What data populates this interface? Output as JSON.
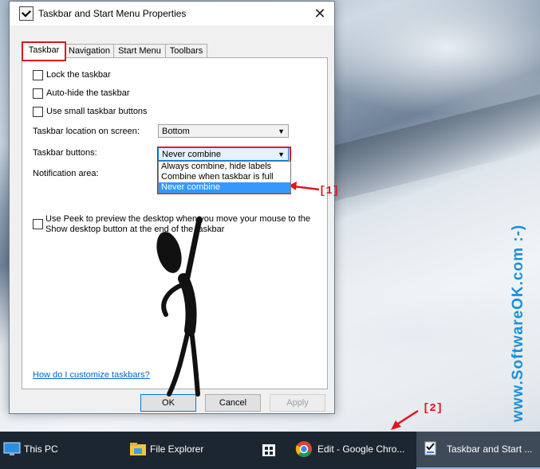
{
  "window": {
    "title": "Taskbar and Start Menu Properties",
    "close_glyph": "✕"
  },
  "tabs": [
    {
      "label": "Taskbar",
      "active": true
    },
    {
      "label": "Navigation",
      "active": false
    },
    {
      "label": "Start Menu",
      "active": false
    },
    {
      "label": "Toolbars",
      "active": false
    }
  ],
  "taskbar_tab": {
    "lock": {
      "label": "Lock the taskbar",
      "checked": false
    },
    "autohide": {
      "label": "Auto-hide the taskbar",
      "checked": false
    },
    "small_buttons": {
      "label": "Use small taskbar buttons",
      "checked": false
    },
    "location": {
      "label": "Taskbar location on screen:",
      "value": "Bottom"
    },
    "buttons": {
      "label": "Taskbar buttons:",
      "value": "Never combine",
      "options": [
        "Always combine, hide labels",
        "Combine when taskbar is full",
        "Never combine"
      ],
      "selected_index": 2
    },
    "notification": {
      "label": "Notification area:"
    },
    "peek": {
      "label": "Use Peek to preview the desktop when you move your mouse to the Show desktop button at the end of the taskbar",
      "checked": false
    },
    "help_link": "How do I customize taskbars?"
  },
  "buttons": {
    "ok": "OK",
    "cancel": "Cancel",
    "apply": "Apply"
  },
  "annotations": {
    "callout_1": "[1]",
    "callout_2": "[2]",
    "color": "#e0141e"
  },
  "watermark": "www.SoftwareOK.com :-)",
  "taskbar": {
    "items": [
      {
        "label": "This PC",
        "icon": "computer-icon"
      },
      {
        "label": "File Explorer",
        "icon": "folder-icon"
      },
      {
        "label": "",
        "icon": "store-icon"
      },
      {
        "label": "Edit - Google Chro...",
        "icon": "chrome-icon"
      },
      {
        "label": "Taskbar and Start ...",
        "icon": "settings-window-icon",
        "active": true
      }
    ]
  }
}
